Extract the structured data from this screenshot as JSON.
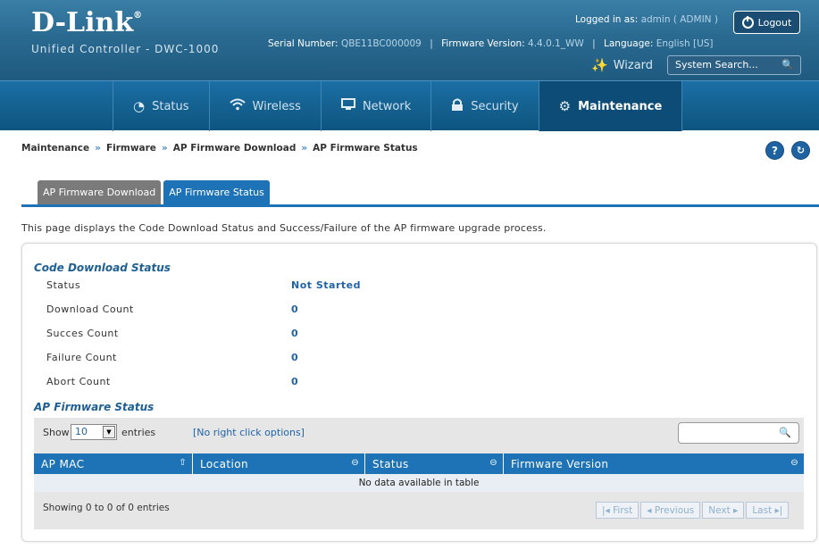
{
  "header": {
    "brand": "D-Link",
    "brand_mark": "®",
    "subtitle": "Unified Controller - DWC-1000",
    "serial_label": "Serial Number:",
    "serial_value": "QBE11BC000009",
    "firmware_label": "Firmware Version:",
    "firmware_value": "4.4.0.1_WW",
    "language_label": "Language:",
    "language_value": "English [US]",
    "logged_label": "Logged in as:",
    "logged_value": "admin ( ADMIN )",
    "logout": "Logout",
    "wizard": "Wizard",
    "search_placeholder": "System Search..."
  },
  "nav": {
    "items": [
      {
        "label": "Status",
        "icon": "gauge-icon"
      },
      {
        "label": "Wireless",
        "icon": "wifi-icon"
      },
      {
        "label": "Network",
        "icon": "monitor-icon"
      },
      {
        "label": "Security",
        "icon": "lock-icon"
      },
      {
        "label": "Maintenance",
        "icon": "gears-icon",
        "active": true
      }
    ]
  },
  "breadcrumb": [
    "Maintenance",
    "Firmware",
    "AP Firmware Download",
    "AP Firmware Status"
  ],
  "breadcrumb_sep": "»",
  "tabs": [
    {
      "label": "AP Firmware Download",
      "active": false
    },
    {
      "label": "AP Firmware Status",
      "active": true
    }
  ],
  "description": "This page displays the Code Download Status and Success/Failure of the AP firmware upgrade process.",
  "code_download": {
    "title": "Code Download Status",
    "rows": [
      {
        "label": "Status",
        "value": "Not Started"
      },
      {
        "label": "Download Count",
        "value": "0"
      },
      {
        "label": "Succes Count",
        "value": "0"
      },
      {
        "label": "Failure Count",
        "value": "0"
      },
      {
        "label": "Abort Count",
        "value": "0"
      }
    ]
  },
  "ap_status": {
    "title": "AP Firmware Status",
    "show_label": "Show",
    "show_value": "10",
    "entries_label": "entries",
    "right_click_note": "[No right click options]",
    "columns": [
      "AP MAC",
      "Location",
      "Status",
      "Firmware Version"
    ],
    "empty_message": "No data available in table",
    "showing": "Showing 0 to 0 of 0 entries",
    "pager": {
      "first": "First",
      "previous": "Previous",
      "next": "Next",
      "last": "Last"
    }
  },
  "colors": {
    "accent": "#1d73b5",
    "nav_bg": "#14608f",
    "link": "#1f63a8"
  }
}
